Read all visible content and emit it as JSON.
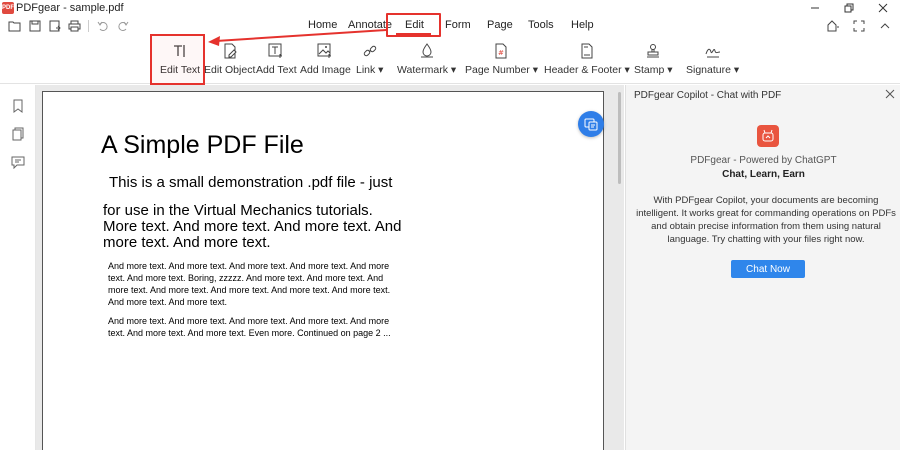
{
  "window": {
    "title": "PDFgear - sample.pdf",
    "logo_text": "PDF"
  },
  "menu": {
    "items": [
      {
        "id": "home",
        "label": "Home"
      },
      {
        "id": "annotate",
        "label": "Annotate"
      },
      {
        "id": "edit",
        "label": "Edit"
      },
      {
        "id": "form",
        "label": "Form"
      },
      {
        "id": "page",
        "label": "Page"
      },
      {
        "id": "tools",
        "label": "Tools"
      },
      {
        "id": "help",
        "label": "Help"
      }
    ],
    "active": "Edit"
  },
  "ribbon": {
    "edit_text": "Edit Text",
    "edit_object": "Edit Object",
    "add_text": "Add Text",
    "add_image": "Add Image",
    "link": "Link ▾",
    "watermark": "Watermark ▾",
    "page_number": "Page Number ▾",
    "header_footer": "Header & Footer ▾",
    "stamp": "Stamp ▾",
    "signature": "Signature ▾"
  },
  "document": {
    "title": "A Simple PDF File",
    "line1": "This is a small demonstration .pdf file -  just",
    "line2": "for use in the Virtual Mechanics tutorials.",
    "line3": "More text. And more  text. And more text.  And",
    "line4": "more text. And more text.",
    "p1": [
      "And more text. And more text. And more text. And more text. And more",
      "text. And more text. Boring, zzzzz. And more text. And more text. And",
      "more text. And more text. And more text. And more text. And more text.",
      "And more text. And more text."
    ],
    "p2": [
      "And more text. And more text. And more text. And more text. And more",
      "text. And more text. And more text. Even more. Continued on page 2 ..."
    ]
  },
  "copilot": {
    "header": "PDFgear Copilot - Chat with PDF",
    "powered": "PDFgear - Powered by ChatGPT",
    "tagline": "Chat, Learn, Earn",
    "description": "With PDFgear Copilot, your documents are becoming intelligent. It works great for commanding operations on PDFs and obtain precise information from them using natural language. Try chatting with your files right now.",
    "button": "Chat Now"
  },
  "colors": {
    "highlight": "#e5322d",
    "accent_blue": "#2f86eb",
    "logo_red": "#e9553f"
  }
}
